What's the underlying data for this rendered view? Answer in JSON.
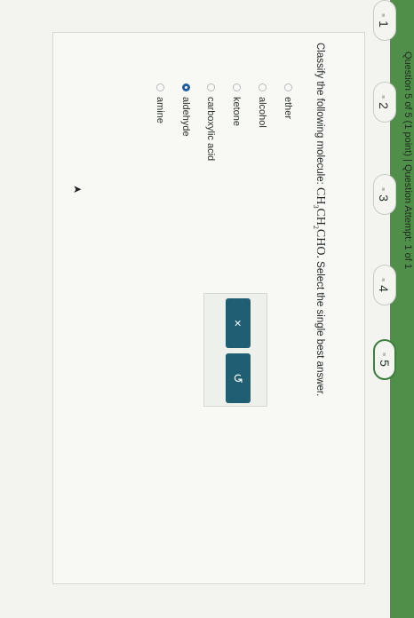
{
  "header": {
    "text": "Question 5 of 5 (1 point)  |  Question Attempt: 1 of 1"
  },
  "nav": {
    "questions": [
      {
        "label": "1",
        "active": false
      },
      {
        "label": "2",
        "active": false
      },
      {
        "label": "3",
        "active": false
      },
      {
        "label": "4",
        "active": false
      },
      {
        "label": "5",
        "active": true
      }
    ]
  },
  "question": {
    "prefix": "Classify the following molecule:",
    "formula": {
      "p1": "CH",
      "s1": "3",
      "p2": "CH",
      "s2": "2",
      "p3": "CHO."
    },
    "suffix": "Select the single best answer."
  },
  "options": [
    {
      "label": "ether",
      "selected": false
    },
    {
      "label": "alcohol",
      "selected": false
    },
    {
      "label": "ketone",
      "selected": false
    },
    {
      "label": "carboxylic acid",
      "selected": false
    },
    {
      "label": "aldehyde",
      "selected": true
    },
    {
      "label": "amine",
      "selected": false
    }
  ],
  "tools": {
    "clear_icon": "close-icon",
    "undo_icon": "undo-icon",
    "clear_glyph": "×",
    "undo_glyph": "↺"
  },
  "colors": {
    "green_bar": "#4f8f4a",
    "tool_button": "#1f5e73",
    "selected_radio": "#1d5fa6"
  }
}
